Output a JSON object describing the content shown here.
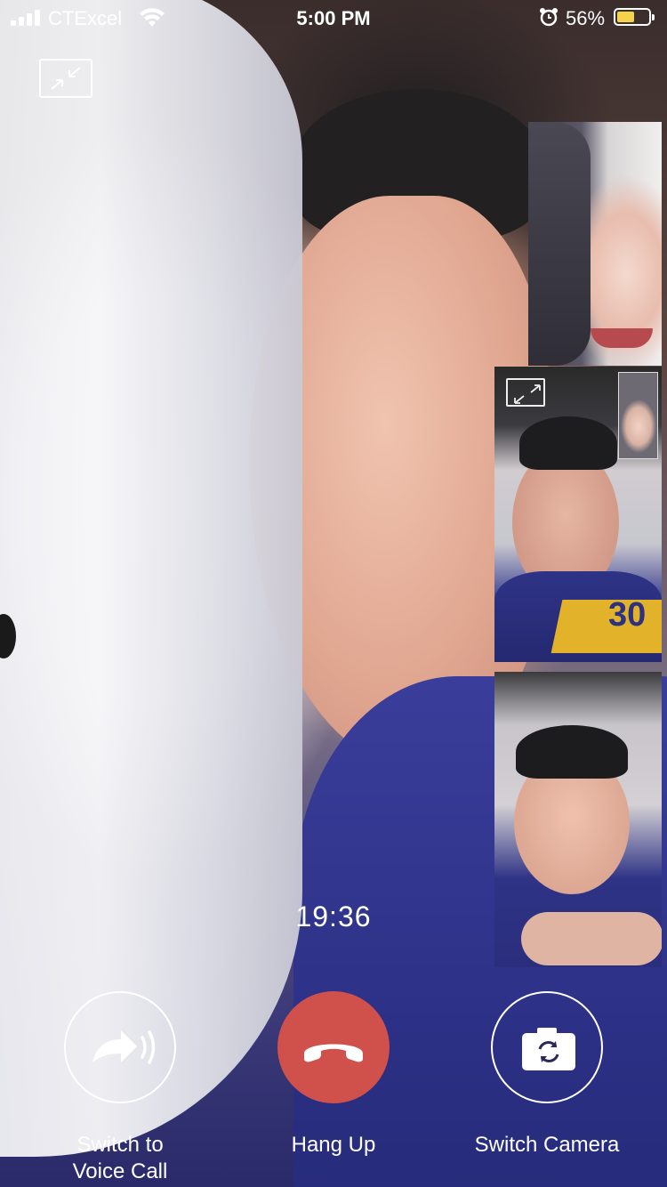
{
  "status_bar": {
    "carrier": "CTExcel",
    "time": "5:00 PM",
    "battery_percent": "56%",
    "battery_level": 0.56,
    "battery_color": "#f6d24a"
  },
  "call": {
    "timer": "19:36"
  },
  "controls": {
    "voice_label_1": "Switch to",
    "voice_label_2": "Voice Call",
    "hangup_label": "Hang Up",
    "camera_label": "Switch Camera",
    "hangup_color": "#d0504c"
  },
  "participants": {
    "jersey_number": "30"
  },
  "icons": {
    "minimize": "minimize-icon",
    "expand": "expand-icon",
    "voice": "voice-call-icon",
    "hangup": "phone-hangup-icon",
    "camera": "switch-camera-icon"
  }
}
